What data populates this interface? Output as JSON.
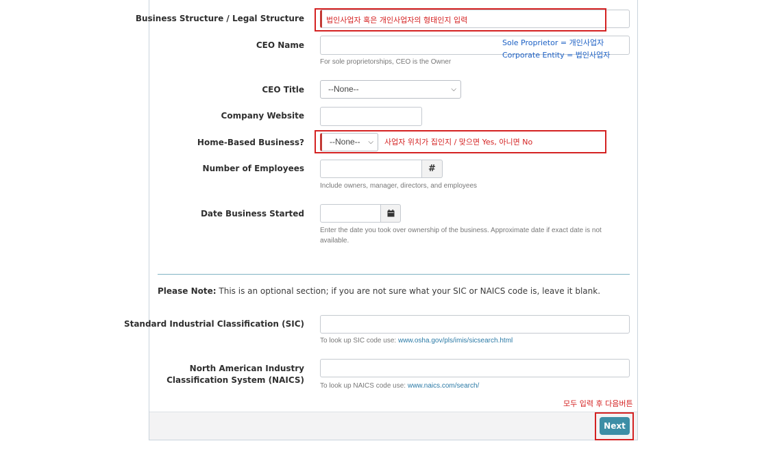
{
  "fields": {
    "business_structure": {
      "label": "Business Structure / Legal Structure",
      "value": ""
    },
    "ceo_name": {
      "label": "CEO Name",
      "value": "",
      "help": "For sole proprietorships, CEO is the Owner"
    },
    "ceo_title": {
      "label": "CEO Title",
      "selected": "--None--"
    },
    "company_website": {
      "label": "Company Website",
      "value": ""
    },
    "home_based": {
      "label": "Home-Based Business?",
      "selected": "--None--"
    },
    "employees": {
      "label": "Number of Employees",
      "value": "",
      "addon": "#",
      "help": "Include owners, manager, directors, and employees"
    },
    "date_started": {
      "label": "Date Business Started",
      "value": "",
      "addon_icon": "calendar-icon",
      "help_line1": "Enter the date you took over ownership of the business. Approximate date if exact date is not",
      "help_line2": "available."
    },
    "sic": {
      "label": "Standard Industrial Classification (SIC)",
      "value": "",
      "help_prefix": "To look up SIC code use: ",
      "help_link": "www.osha.gov/pls/imis/sicsearch.html"
    },
    "naics": {
      "label": "North American Industry Classification System (NAICS)",
      "value": "",
      "help_prefix": "To look up NAICS code use: ",
      "help_link": "www.naics.com/search/"
    }
  },
  "note": {
    "bold": "Please Note:",
    "text": " This is an optional section; if you are not sure what your SIC or NAICS code is, leave it blank."
  },
  "annotations": {
    "business_structure": "법인사업자 혹은 개인사업자의 형태인지 입력",
    "sole_proprietor": "Sole Proprietor = 개인사업자",
    "corporate_entity": "Corporate Entity = 법인사업자",
    "home_based": "사업자 위치가 집인지 / 맞으면 Yes, 아니면 No",
    "next_hint": "모두 입력 후 다음버튼"
  },
  "buttons": {
    "next": "Next"
  },
  "colors": {
    "annotation_red": "#d42020",
    "annotation_blue": "#1a5fc4",
    "button": "#3d8ea6",
    "required_bar": "#c23934"
  }
}
